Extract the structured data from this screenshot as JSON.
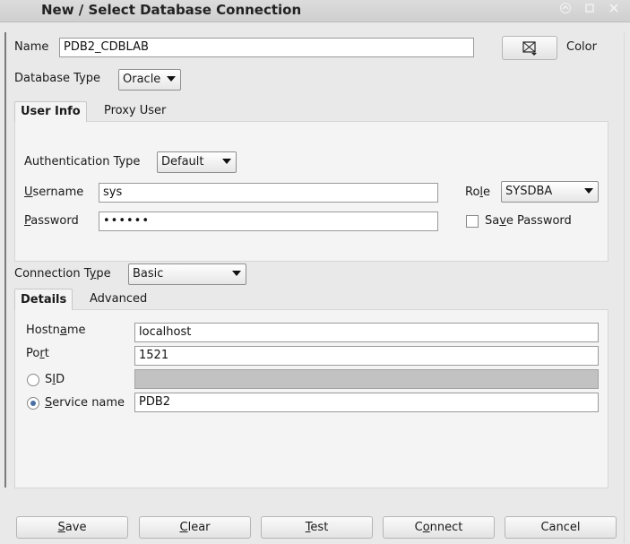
{
  "window": {
    "title": "New / Select Database Connection",
    "controls": [
      "up-arrow",
      "restore",
      "close"
    ]
  },
  "name": {
    "label": "Name",
    "value": "PDB2_CDBLAB"
  },
  "color": {
    "label": "Color",
    "icon": "color-picker-icon"
  },
  "database_type": {
    "label": "Database Type",
    "value": "Oracle"
  },
  "user_tabs": [
    {
      "label": "User Info",
      "active": true
    },
    {
      "label": "Proxy User",
      "active": false
    }
  ],
  "auth": {
    "label": "Authentication Type",
    "value": "Default"
  },
  "username": {
    "label": "Username",
    "mnemonic": "U",
    "rest": "sername",
    "value": "sys"
  },
  "password": {
    "label": "Password",
    "mnemonic": "P",
    "rest": "assword",
    "value": "••••••"
  },
  "role": {
    "label": "Role",
    "pre": "Ro",
    "mnemonic": "l",
    "post": "e",
    "value": "SYSDBA"
  },
  "save_password": {
    "pre": "Sa",
    "mnemonic": "v",
    "post": "e Password",
    "checked": false
  },
  "connection_type": {
    "pre": "Connection T",
    "mnemonic": "y",
    "post": "pe",
    "value": "Basic"
  },
  "detail_tabs": [
    {
      "label": "Details",
      "active": true
    },
    {
      "label": "Advanced",
      "active": false
    }
  ],
  "hostname": {
    "pre": "Hostn",
    "mnemonic": "a",
    "post": "me",
    "value": "localhost"
  },
  "port": {
    "pre": "Po",
    "mnemonic": "r",
    "post": "t",
    "value": "1521"
  },
  "sid": {
    "pre": "S",
    "mnemonic": "I",
    "post": "D",
    "value": "",
    "selected": false
  },
  "service_name": {
    "mnemonic": "S",
    "rest": "ervice name",
    "value": "PDB2",
    "selected": true
  },
  "buttons": {
    "save": {
      "mnemonic": "S",
      "rest": "ave"
    },
    "clear": {
      "mnemonic": "C",
      "rest": "lear"
    },
    "test": {
      "mnemonic": "T",
      "rest": "est"
    },
    "connect": {
      "pre": "C",
      "mnemonic": "o",
      "post": "nnect"
    },
    "cancel": {
      "label": "Cancel"
    }
  }
}
